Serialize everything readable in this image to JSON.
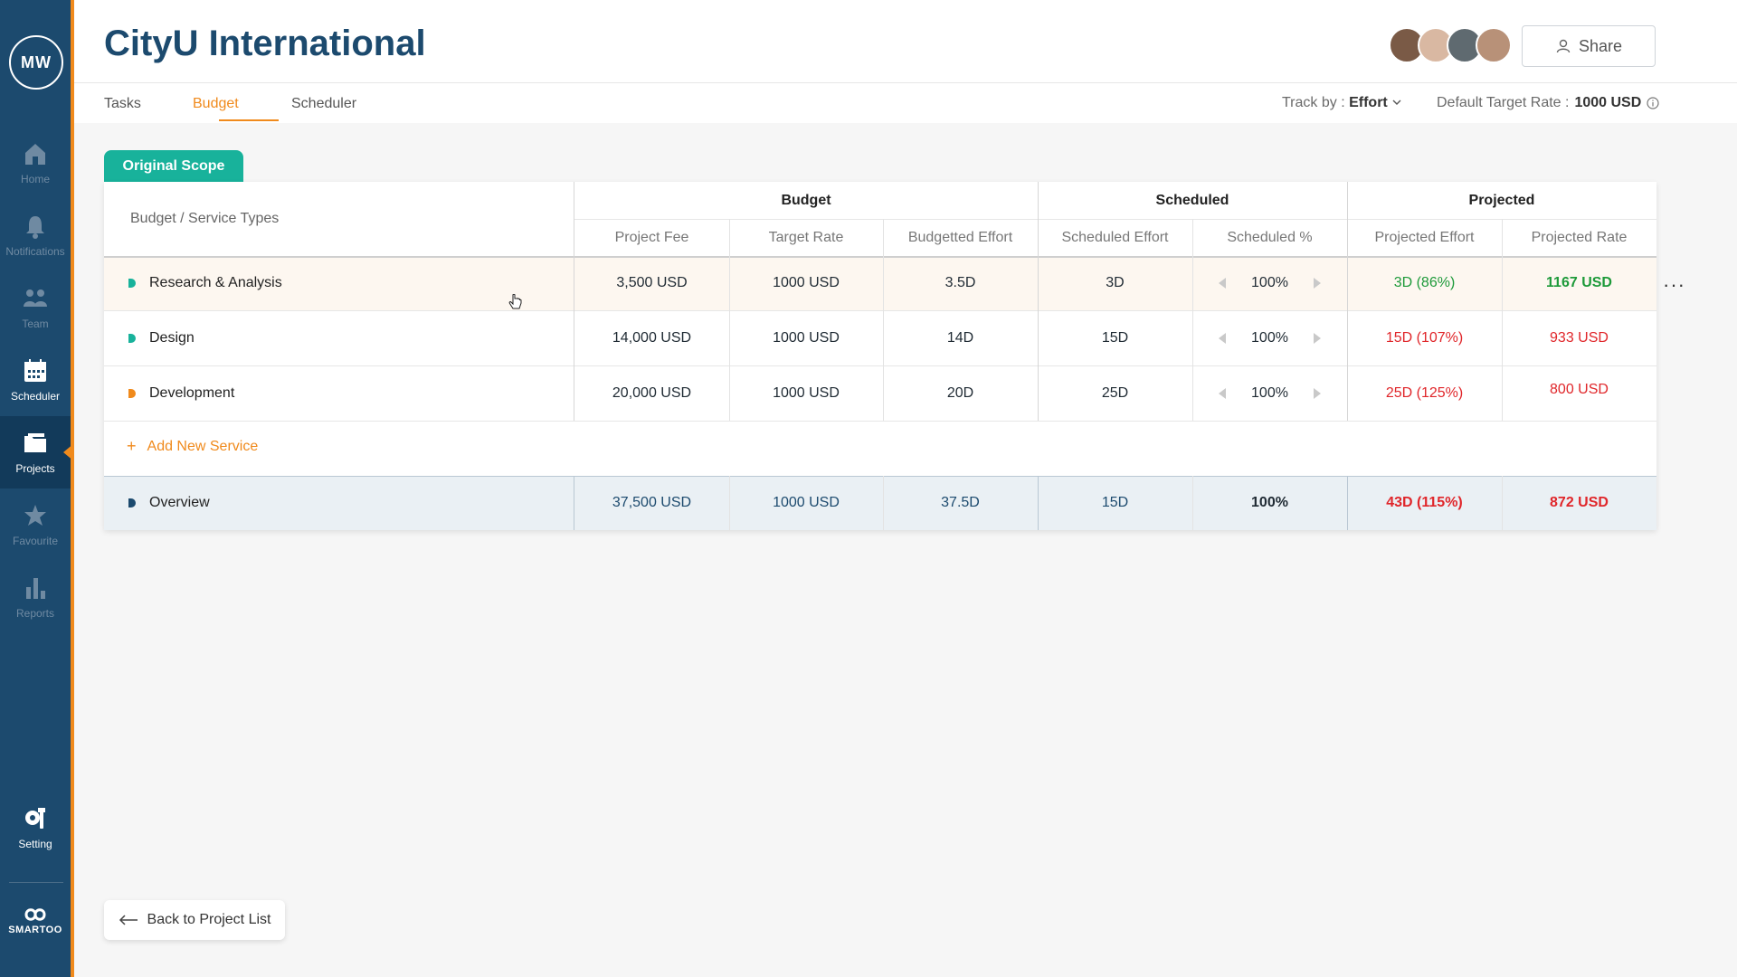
{
  "user": {
    "initials": "MW"
  },
  "sidebar": {
    "items": [
      {
        "label": "Home",
        "icon": "home-icon"
      },
      {
        "label": "Notifications",
        "icon": "bell-icon"
      },
      {
        "label": "Team",
        "icon": "team-icon"
      },
      {
        "label": "Scheduler",
        "icon": "calendar-icon"
      },
      {
        "label": "Projects",
        "icon": "folder-icon"
      },
      {
        "label": "Favourite",
        "icon": "star-icon"
      },
      {
        "label": "Reports",
        "icon": "bar-chart-icon"
      }
    ],
    "setting_label": "Setting",
    "brand_label": "SMARTOO"
  },
  "header": {
    "title": "CityU International",
    "share_label": "Share"
  },
  "tabs": [
    {
      "label": "Tasks"
    },
    {
      "label": "Budget",
      "active": true
    },
    {
      "label": "Scheduler"
    }
  ],
  "toolbar": {
    "track_by_label": "Track by :",
    "track_by_value": "Effort",
    "default_rate_label": "Default Target Rate :",
    "default_rate_value": "1000 USD"
  },
  "scope_tab": "Original Scope",
  "table": {
    "left_header": "Budget / Service Types",
    "groups": [
      "Budget",
      "Scheduled",
      "Projected"
    ],
    "columns": [
      "Project Fee",
      "Target Rate",
      "Budgetted Effort",
      "Scheduled Effort",
      "Scheduled %",
      "Projected Effort",
      "Projected Rate"
    ],
    "rows": [
      {
        "name": "Research & Analysis",
        "dot_color": "#18b29b",
        "fee": "3,500 USD",
        "rate": "1000 USD",
        "budget_effort": "3.5D",
        "sched_effort": "3D",
        "sched_pct": "100%",
        "proj_effort": "3D (86%)",
        "proj_rate": "1167 USD",
        "status": "green"
      },
      {
        "name": "Design",
        "dot_color": "#18b29b",
        "fee": "14,000 USD",
        "rate": "1000 USD",
        "budget_effort": "14D",
        "sched_effort": "15D",
        "sched_pct": "100%",
        "proj_effort": "15D (107%)",
        "proj_rate": "933 USD",
        "status": "red"
      },
      {
        "name": "Development",
        "dot_color": "#f08a1c",
        "fee": "20,000 USD",
        "rate": "1000 USD",
        "budget_effort": "20D",
        "sched_effort": "25D",
        "sched_pct": "100%",
        "proj_effort": "25D (125%)",
        "proj_rate": "800 USD",
        "status": "red"
      }
    ],
    "add_service_label": "Add New Service",
    "overview": {
      "name": "Overview",
      "fee": "37,500 USD",
      "rate": "1000 USD",
      "budget_effort": "37.5D",
      "sched_effort": "15D",
      "sched_pct": "100%",
      "proj_effort": "43D (115%)",
      "proj_rate": "872 USD"
    },
    "more_label": "···"
  },
  "back_label": "Back to Project List",
  "colors": {
    "sidebar": "#1c4a6e",
    "accent": "#f08a1c",
    "teal": "#18b29b",
    "good": "#1e9a3a",
    "bad": "#e0262a"
  }
}
